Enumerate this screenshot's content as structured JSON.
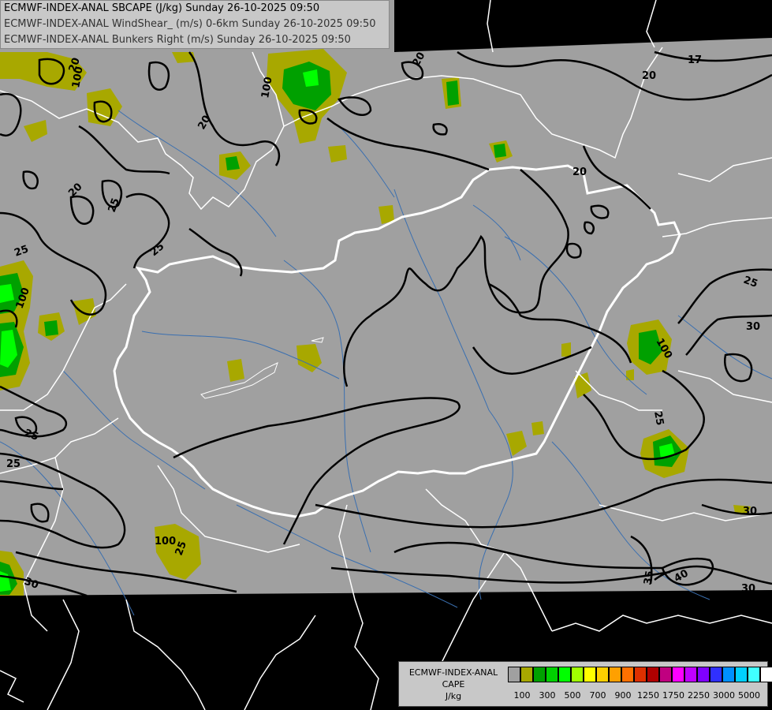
{
  "header": {
    "line1": "ECMWF-INDEX-ANAL SBCAPE (J/kg) Sunday 26-10-2025 09:50",
    "line2": "ECMWF-INDEX-ANAL WindShear_ (m/s) 0-6km Sunday 26-10-2025 09:50",
    "line3": "ECMWF-INDEX-ANAL Bunkers Right (m/s) Sunday 26-10-2025 09:50"
  },
  "legend": {
    "title1": "ECMWF-INDEX-ANAL",
    "title2": "CAPE",
    "unit": "J/kg",
    "swatch_colors": [
      "#a0a0a0",
      "#a8a800",
      "#00a000",
      "#00d000",
      "#00ff00",
      "#a0ff00",
      "#ffff00",
      "#ffd000",
      "#ffa000",
      "#ff7000",
      "#dd3000",
      "#b00000",
      "#c00080",
      "#ff00ff",
      "#c000ff",
      "#8000ff",
      "#3030ff",
      "#0090ff",
      "#00d0ff",
      "#40ffff",
      "#ffffff"
    ],
    "ticks": [
      "100",
      "300",
      "500",
      "700",
      "900",
      "1250",
      "1750",
      "2250",
      "3000",
      "5000"
    ]
  },
  "colors": {
    "background": "#000000",
    "data_area": "#a0a0a0",
    "cape_100": "#a8a800",
    "cape_300": "#00a000",
    "cape_500": "#00d000",
    "cape_700": "#00ff00",
    "borders": "#ffffff",
    "rivers": "#3a6fb0",
    "shear_contours": "#000000"
  },
  "contour_labels": {
    "l1": "17",
    "l2": "20",
    "l3": "20",
    "l4": "20",
    "l5": "20",
    "l6": "20",
    "l7": "20",
    "l8": "25",
    "l9": "25",
    "l10": "25",
    "l11": "25",
    "l12": "25",
    "l13": "25",
    "l14": "25",
    "l15": "30",
    "l16": "30",
    "l17": "30",
    "l18": "30",
    "l19": "35",
    "l20": "40",
    "l21": "25",
    "l22": "100",
    "l23": "100",
    "l24": "100",
    "l25": "100",
    "l26": "100",
    "l27": "25"
  }
}
